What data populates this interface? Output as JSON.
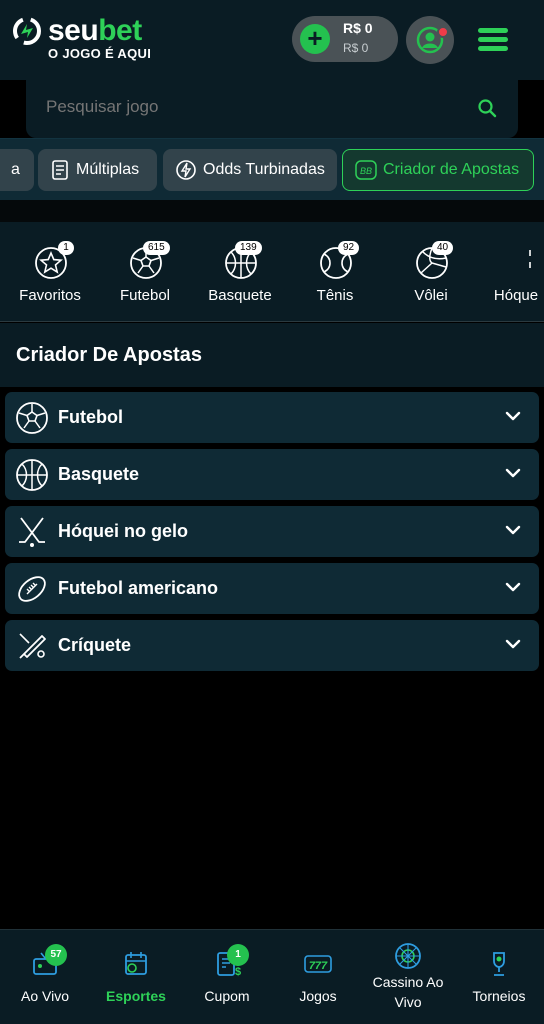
{
  "brand": {
    "name_a": "seu",
    "name_b": "bet",
    "tagline": "O JOGO É AQUI",
    "accent": "#2ed158"
  },
  "balance": {
    "main": "R$ 0",
    "sub": "R$ 0"
  },
  "search": {
    "placeholder": "Pesquisar jogo"
  },
  "chips": [
    {
      "label": "a",
      "icon": "partial-chip"
    },
    {
      "label": "Múltiplas",
      "icon": "multiples-icon"
    },
    {
      "label": "Odds Turbinadas",
      "icon": "boost-icon"
    },
    {
      "label": "Criador de Apostas",
      "icon": "bet-builder-icon",
      "active": true
    }
  ],
  "sports": [
    {
      "label": "Favoritos",
      "count": "1",
      "icon": "star-icon"
    },
    {
      "label": "Futebol",
      "count": "615",
      "icon": "soccer-ball-icon"
    },
    {
      "label": "Basquete",
      "count": "139",
      "icon": "basketball-icon"
    },
    {
      "label": "Tênis",
      "count": "92",
      "icon": "tennis-ball-icon"
    },
    {
      "label": "Vôlei",
      "count": "40",
      "icon": "volleyball-icon"
    },
    {
      "label": "Hóque",
      "count": "",
      "icon": "hockey-icon"
    }
  ],
  "section": {
    "title": "Criador De Apostas"
  },
  "list": [
    {
      "label": "Futebol",
      "icon": "soccer-ball-icon"
    },
    {
      "label": "Basquete",
      "icon": "basketball-icon"
    },
    {
      "label": "Hóquei no gelo",
      "icon": "hockey-sticks-icon"
    },
    {
      "label": "Futebol americano",
      "icon": "american-football-icon"
    },
    {
      "label": "Críquete",
      "icon": "cricket-icon"
    }
  ],
  "bottom_nav": [
    {
      "label": "Ao Vivo",
      "badge": "57",
      "icon": "live-tv-icon"
    },
    {
      "label": "Esportes",
      "badge": "",
      "icon": "sports-calendar-icon",
      "active": true
    },
    {
      "label": "Cupom",
      "badge": "1",
      "icon": "coupon-icon"
    },
    {
      "label": "Jogos",
      "badge": "",
      "icon": "slots-777-icon"
    },
    {
      "label": "Cassino Ao Vivo",
      "badge": "",
      "icon": "roulette-icon"
    },
    {
      "label": "Torneios",
      "badge": "",
      "icon": "trophy-icon"
    }
  ]
}
